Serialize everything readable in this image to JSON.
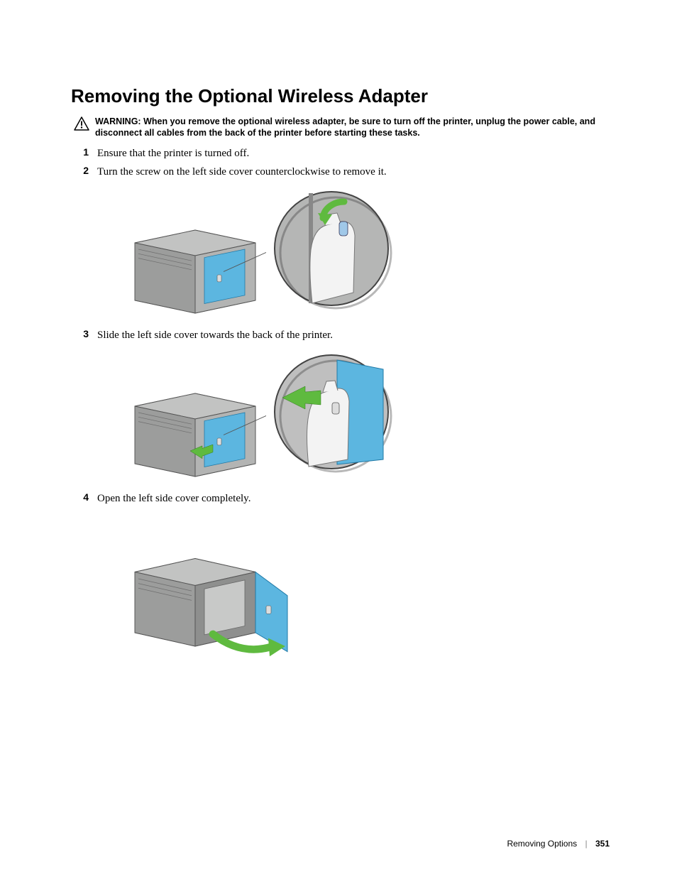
{
  "heading": "Removing the Optional Wireless Adapter",
  "warning": {
    "label": "WARNING:",
    "text": "When you remove the optional wireless adapter, be sure to turn off the printer, unplug the power cable, and disconnect all cables from the back of the printer before starting these tasks."
  },
  "steps": {
    "s1": {
      "num": "1",
      "text": "Ensure that the printer is turned off."
    },
    "s2": {
      "num": "2",
      "text": "Turn the screw on the left side cover counterclockwise to remove it."
    },
    "s3": {
      "num": "3",
      "text": "Slide the left side cover towards the back of the printer."
    },
    "s4": {
      "num": "4",
      "text": "Open the left side cover completely."
    }
  },
  "footer": {
    "section": "Removing Options",
    "page": "351"
  },
  "figures": {
    "fig1_alt": "Printer with screw being turned counterclockwise on left cover",
    "fig2_alt": "Printer with left side cover sliding towards back",
    "fig3_alt": "Printer with left side cover opened completely"
  }
}
